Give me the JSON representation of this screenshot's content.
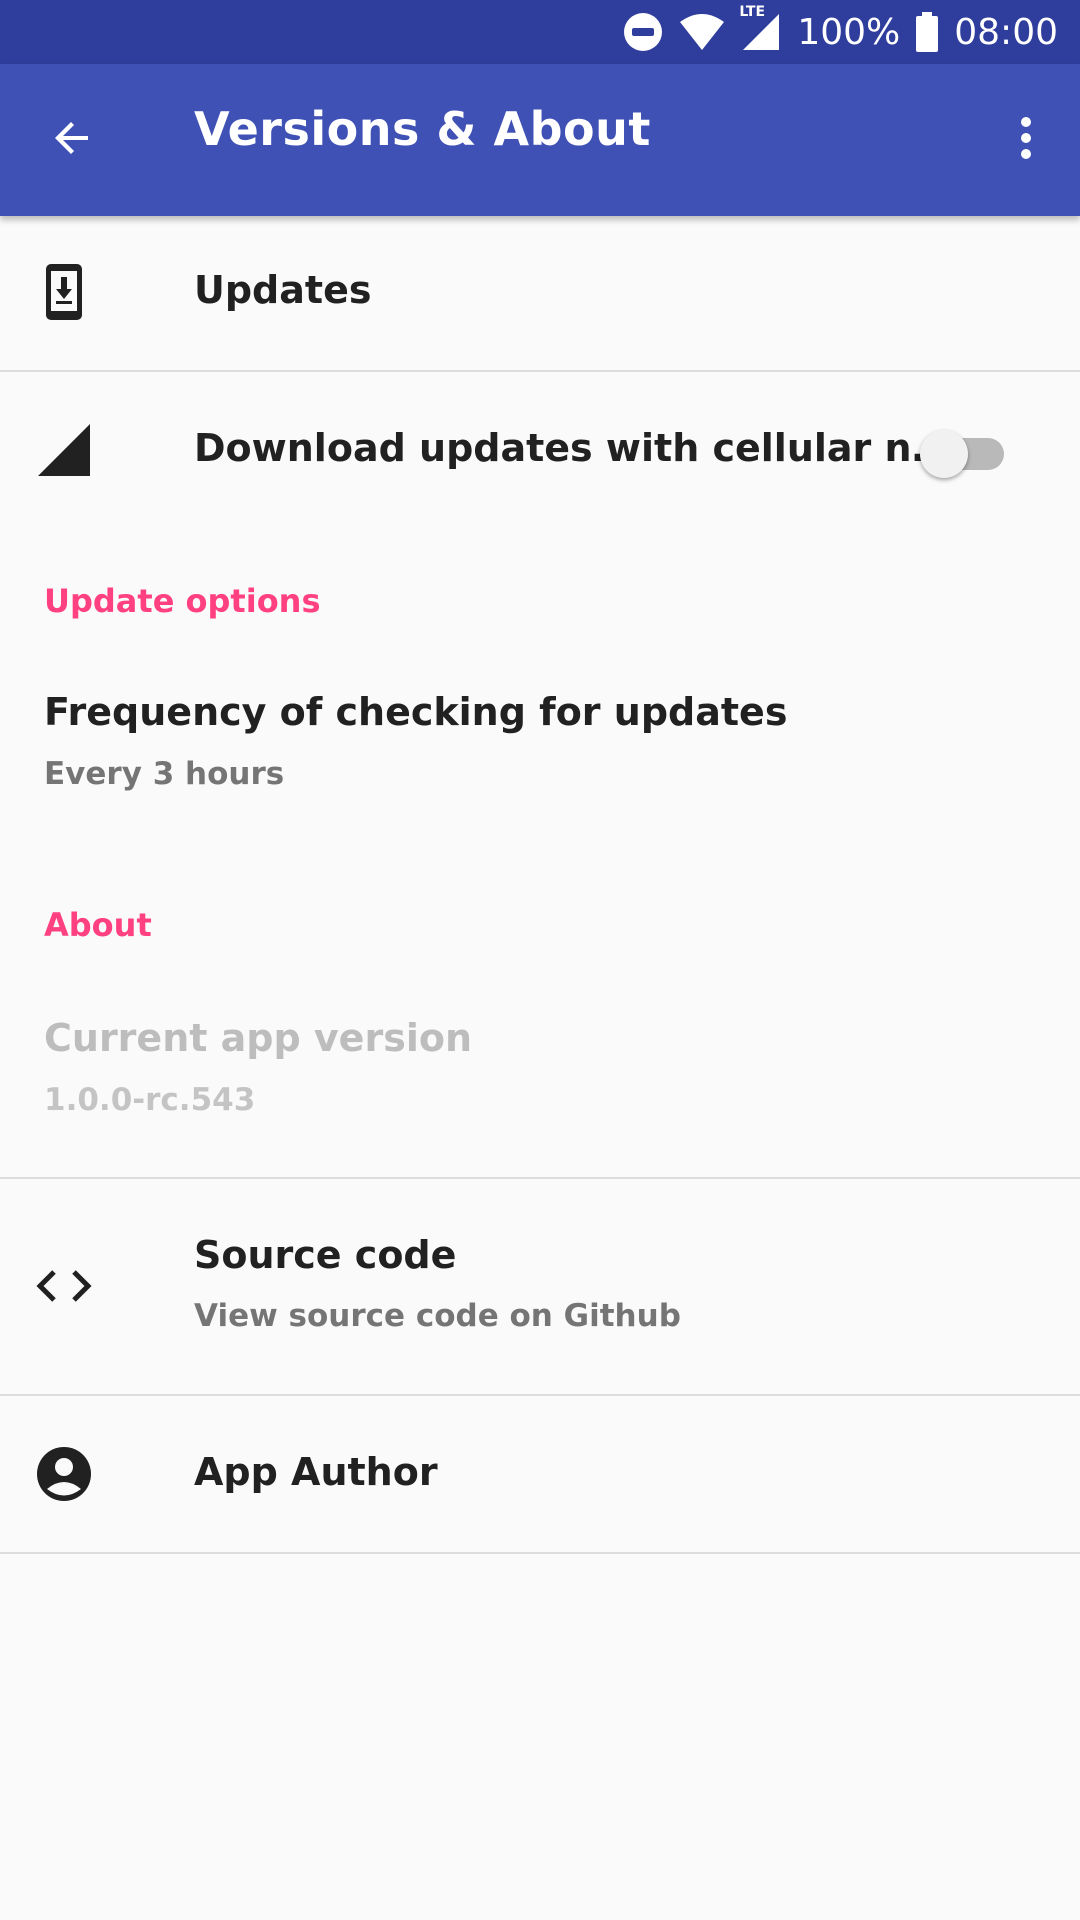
{
  "status_bar": {
    "battery": "100%",
    "time": "08:00",
    "network_label": "LTE",
    "icons": [
      "do-not-disturb-icon",
      "wifi-icon",
      "cell-signal-icon",
      "battery-icon"
    ]
  },
  "app_bar": {
    "title": "Versions & About",
    "back_icon": "arrow-back-icon",
    "more_icon": "more-vert-icon"
  },
  "updates": {
    "title": "Updates",
    "icon": "phone-download-icon"
  },
  "cellular": {
    "title": "Download updates with cellular n…",
    "icon": "cell-signal-icon",
    "toggle_on": false
  },
  "update_options": {
    "header": "Update options",
    "frequency_title": "Frequency of checking for updates",
    "frequency_value": "Every 3 hours"
  },
  "about": {
    "header": "About",
    "version_title": "Current app version",
    "version_value": "1.0.0-rc.543"
  },
  "source_code": {
    "title": "Source code",
    "subtitle": "View source code on Github",
    "icon": "code-icon"
  },
  "app_author": {
    "title": "App Author",
    "icon": "account-circle-icon"
  },
  "colors": {
    "status_bar": "#2f3d9c",
    "app_bar": "#3f51b5",
    "accent": "#ff4081",
    "background": "#fafafa"
  }
}
